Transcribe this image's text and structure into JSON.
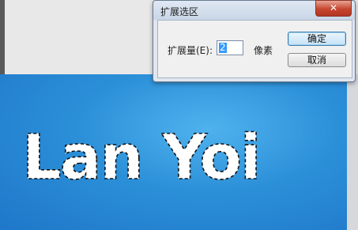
{
  "dialog": {
    "title": "扩展选区",
    "close_glyph": "✕",
    "expand_label": "扩展量(E):",
    "expand_value": "2",
    "unit": "像素",
    "ok_label": "确定",
    "cancel_label": "取消"
  },
  "canvas": {
    "image_text": "Lan Yoi",
    "background_color": "#2b8fd8",
    "text_color": "#ffffff"
  }
}
